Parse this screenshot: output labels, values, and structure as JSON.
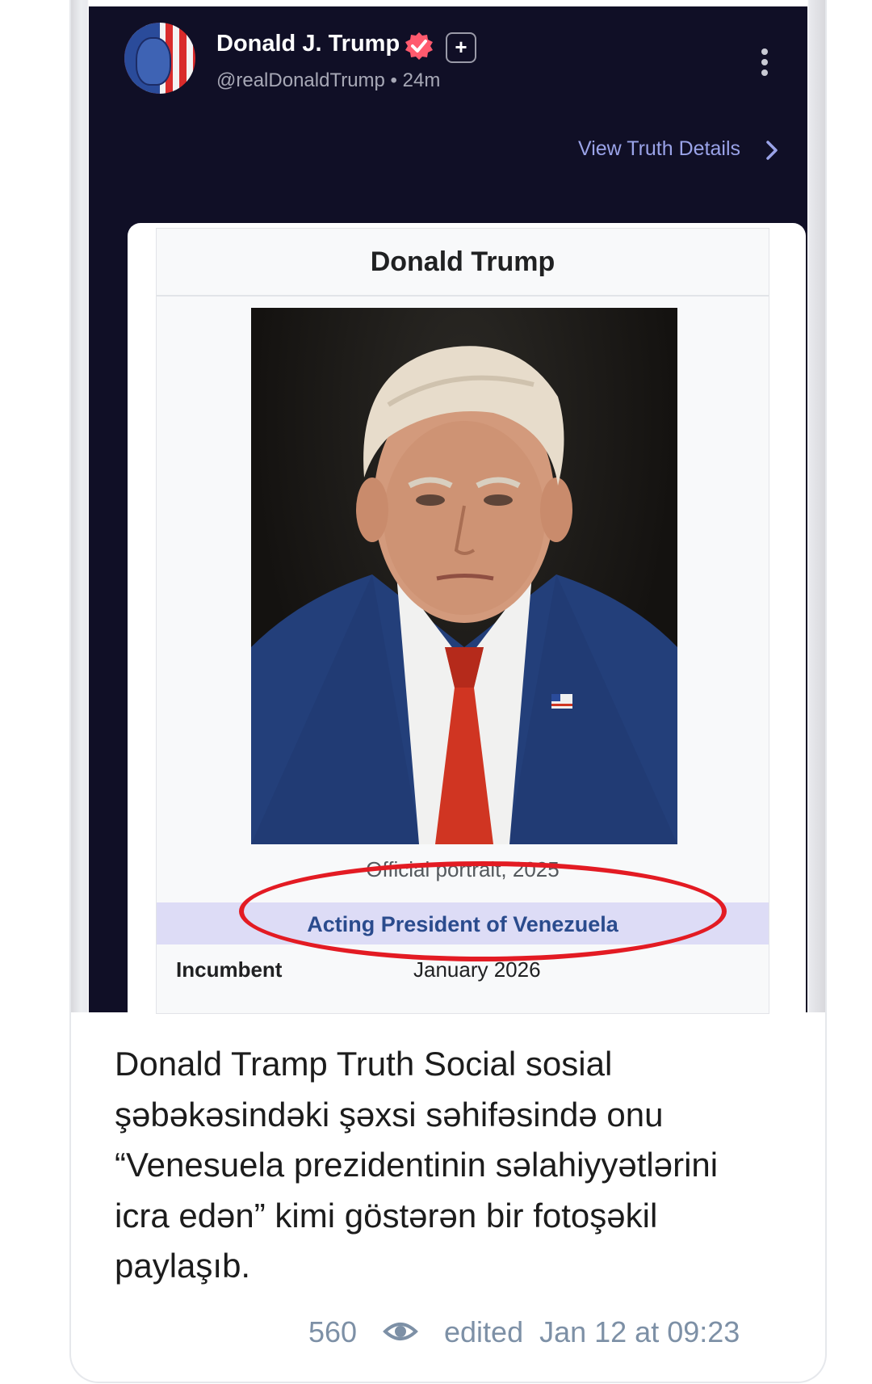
{
  "post": {
    "author_name": "Donald J. Trump",
    "handle": "@realDonaldTrump",
    "time": "24m",
    "view_details": "View Truth Details"
  },
  "infobox": {
    "title": "Donald Trump",
    "caption": "Official portrait, 2025",
    "role": "Acting President of Venezuela",
    "incumbent_label": "Incumbent",
    "incumbent_date": "January 2026"
  },
  "message": {
    "text": "Donald Tramp Truth Social sosial şəbəkəsindəki şəxsi səhifəsində onu “Venesuela prezidentinin səlahiyyətlərini icra edən” kimi göstərən bir fotoşəkil paylaşıb.",
    "views": "560",
    "edited": "edited  Jan 12 at 09:23"
  },
  "colors": {
    "post_background": "#100f26",
    "verified": "#ff5a6e",
    "link": "#9aa3e8",
    "highlight_circle": "#e31b23",
    "meta_text": "#7d90a6"
  }
}
